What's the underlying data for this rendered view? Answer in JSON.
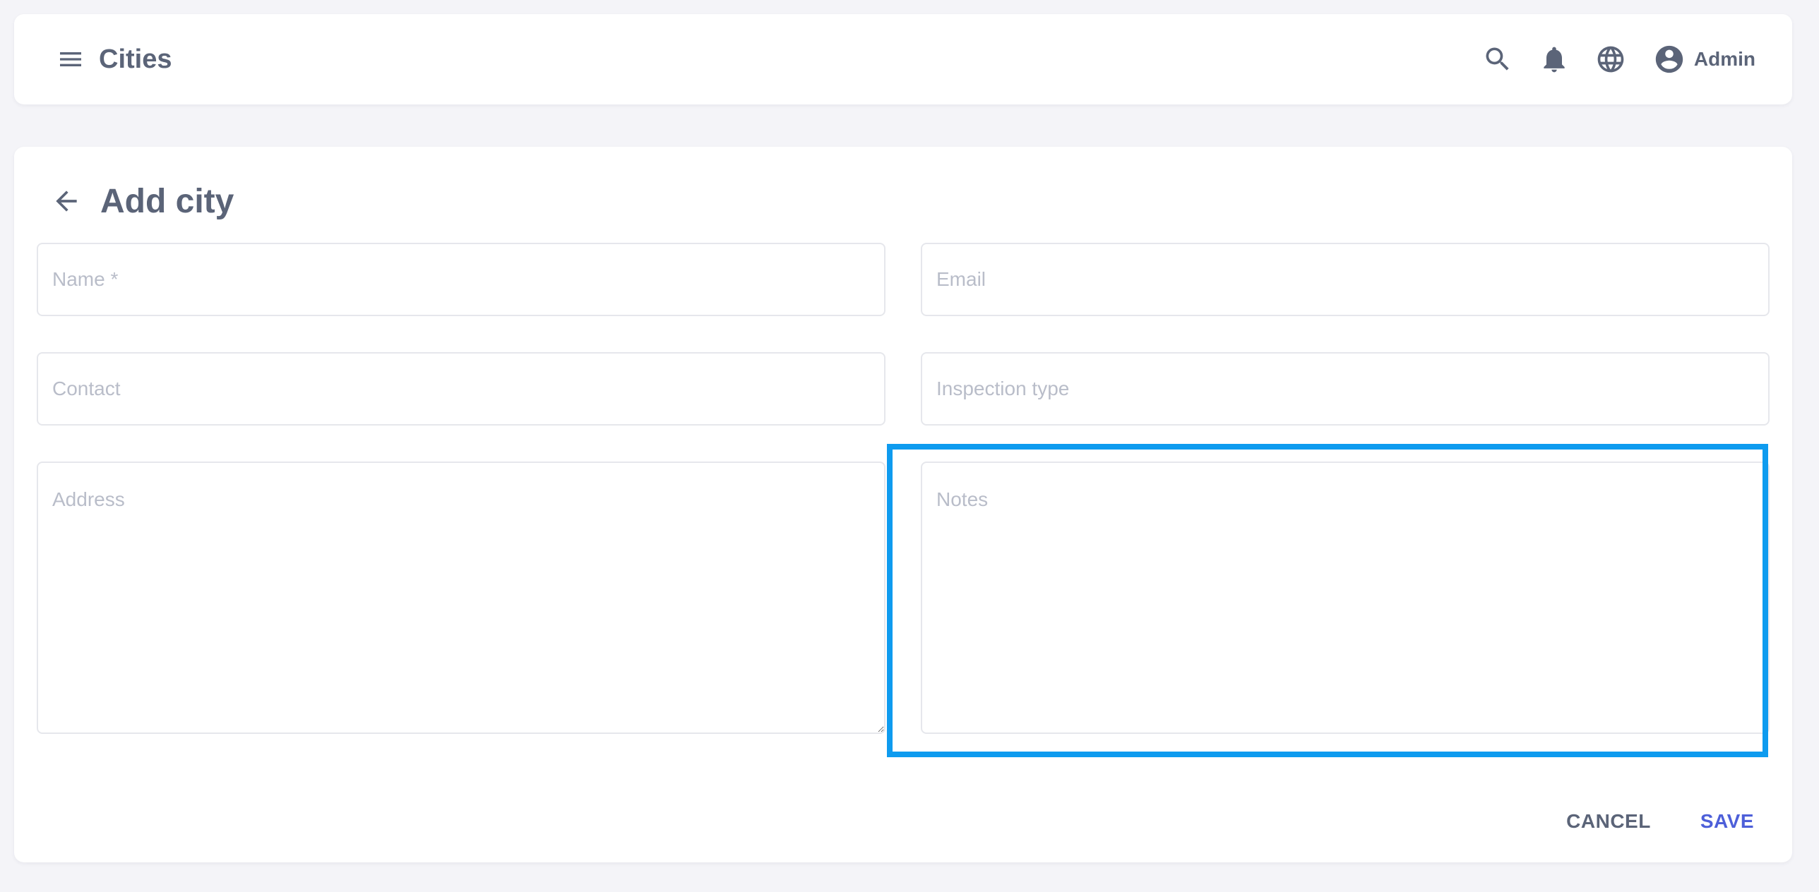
{
  "header": {
    "title": "Cities",
    "icons": {
      "menu": "menu-icon",
      "search": "search-icon",
      "notifications": "bell-icon",
      "language": "globe-icon",
      "account": "account-circle-icon"
    },
    "user_name": "Admin"
  },
  "page": {
    "title": "Add city",
    "back_icon": "arrow-left-icon"
  },
  "form": {
    "name": {
      "value": "",
      "placeholder": "Name *"
    },
    "email": {
      "value": "",
      "placeholder": "Email"
    },
    "contact": {
      "value": "",
      "placeholder": "Contact"
    },
    "inspection_type": {
      "value": "",
      "placeholder": "Inspection type"
    },
    "address": {
      "value": "",
      "placeholder": "Address"
    },
    "notes": {
      "value": "",
      "placeholder": "Notes"
    }
  },
  "actions": {
    "cancel_label": "CANCEL",
    "save_label": "SAVE"
  },
  "colors": {
    "text": "#5b6478",
    "accent": "#4d5fd9",
    "highlight": "#0e9bef",
    "background": "#f4f4f8",
    "placeholder": "#b9bdc9"
  }
}
